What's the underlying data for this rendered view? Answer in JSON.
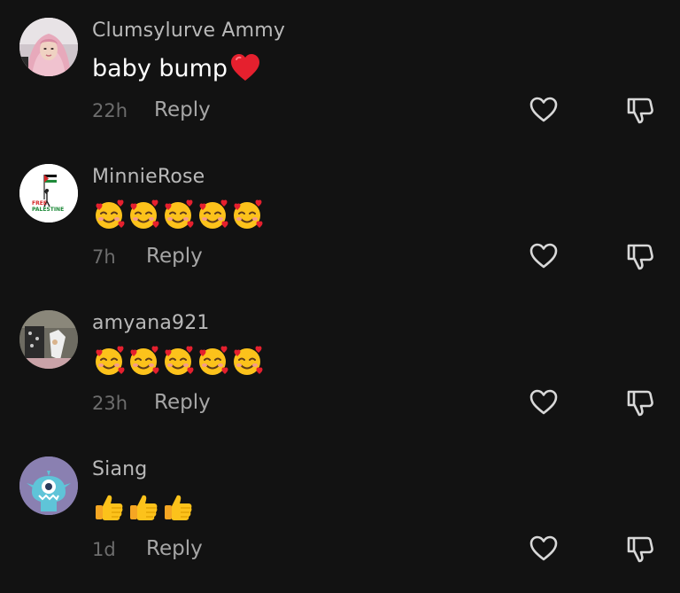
{
  "comments": [
    {
      "username": "Clumsylurve Ammy",
      "text": "baby bump",
      "trailing_emoji": "red-heart",
      "timestamp": "22h",
      "reply_label": "Reply"
    },
    {
      "username": "MinnieRose",
      "emojis": [
        "smiling-face-with-hearts",
        "smiling-face-with-hearts",
        "smiling-face-with-hearts",
        "smiling-face-with-hearts",
        "smiling-face-with-hearts"
      ],
      "timestamp": "7h",
      "reply_label": "Reply",
      "avatar_text": [
        "FREE",
        "PALESTINE"
      ]
    },
    {
      "username": "amyana921",
      "emojis": [
        "smiling-face-with-hearts",
        "smiling-face-with-hearts",
        "smiling-face-with-hearts",
        "smiling-face-with-hearts",
        "smiling-face-with-hearts"
      ],
      "timestamp": "23h",
      "reply_label": "Reply"
    },
    {
      "username": "Siang",
      "emojis": [
        "thumbs-up",
        "thumbs-up",
        "thumbs-up"
      ],
      "timestamp": "1d",
      "reply_label": "Reply"
    }
  ],
  "icons": {
    "like": "heart-outline-icon",
    "dislike": "thumbs-down-outline-icon"
  },
  "colors": {
    "background": "#121212",
    "username": "#b9b9b9",
    "timestamp": "#6d6d6d",
    "reply": "#a6a6a6",
    "icon": "#d8d8d8"
  }
}
